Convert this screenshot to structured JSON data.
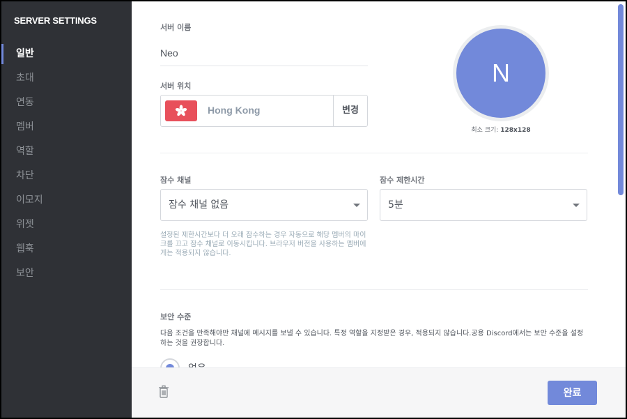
{
  "sidebar": {
    "title": "SERVER SETTINGS",
    "items": [
      {
        "label": "일반",
        "active": true
      },
      {
        "label": "초대"
      },
      {
        "label": "연동"
      },
      {
        "label": "멤버"
      },
      {
        "label": "역할"
      },
      {
        "label": "차단"
      },
      {
        "label": "이모지"
      },
      {
        "label": "위젯"
      },
      {
        "label": "웹훅"
      },
      {
        "label": "보안"
      }
    ]
  },
  "main": {
    "server_name_label": "서버 이름",
    "server_name_value": "Neo",
    "server_region_label": "서버 위치",
    "server_region_value": "Hong Kong",
    "region_change_label": "변경",
    "avatar_letter": "N",
    "avatar_hint_prefix": "최소 크기: ",
    "avatar_hint_size": "128x128",
    "afk_channel_label": "잠수 채널",
    "afk_channel_value": "잠수 채널 없음",
    "afk_timeout_label": "잠수 제한시간",
    "afk_timeout_value": "5분",
    "afk_help": "설정된 제한시간보다 더 오래 잠수하는 경우 자동으로 해당 멤버의 마이크를 끄고 잠수 채널로 이동시킵니다. 브라우저 버전을 사용하는 멤버에게는 적용되지 않습니다.",
    "security_label": "보안 수준",
    "security_desc": "다음 조건을 만족해야만 채널에 메시지를 보낼 수 있습니다. 특정 역할을 지정받은 경우, 적용되지 않습니다.공용 Discord에서는 보안 수준을 설정하는 것을 권장합니다.",
    "radio_none_label": "없음"
  },
  "footer": {
    "done_label": "완료"
  },
  "colors": {
    "accent": "#7289da",
    "sidebar_bg": "#2f3136",
    "flag_red": "#e8505b"
  }
}
